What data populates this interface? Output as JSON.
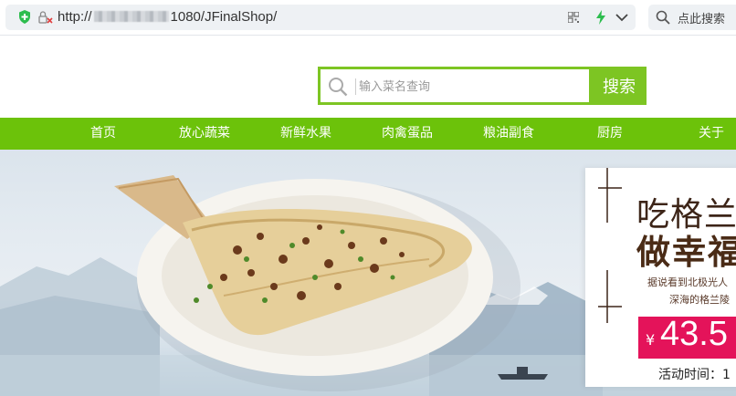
{
  "browser": {
    "url_prefix": "http://",
    "url_suffix": "1080/JFinalShop/",
    "search_placeholder": "点此搜索",
    "icons": [
      "shield-icon",
      "lock-x-icon",
      "qr-icon",
      "bolt-icon",
      "chevron-down-icon",
      "search-icon"
    ]
  },
  "header": {
    "search_placeholder": "输入菜名查询",
    "search_button": "搜索",
    "accent_color": "#7dc523"
  },
  "nav": {
    "color": "#6cc20a",
    "items": [
      "首页",
      "放心蔬菜",
      "新鲜水果",
      "肉禽蛋品",
      "粮油副食",
      "厨房",
      "关于"
    ]
  },
  "banner": {
    "promo": {
      "title_line1": "吃格兰",
      "title_line2": "做幸福",
      "desc_line1": "据说看到北极光人",
      "desc_line2": "深海的格兰陵",
      "currency": "¥",
      "price": "43.5",
      "activity_time": "活动时间：1"
    },
    "price_color": "#e4135a"
  }
}
